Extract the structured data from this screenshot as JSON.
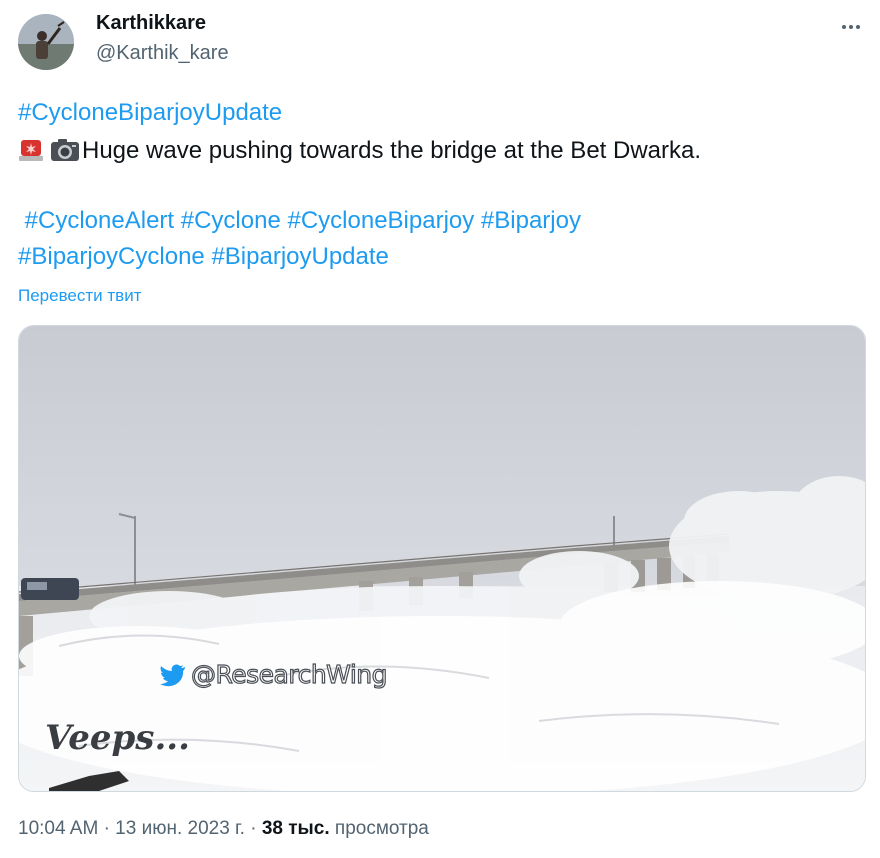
{
  "author": {
    "name": "Karthikkare",
    "handle": "@Karthik_kare"
  },
  "tweet": {
    "hashtag_top": "#CycloneBiparjoyUpdate",
    "emoji": [
      "rotating-light-icon",
      "camera-icon"
    ],
    "body": "Huge wave pushing towards the bridge at the Bet Dwarka.",
    "hashtags_line1": [
      "#CycloneAlert",
      "#Cyclone",
      "#CycloneBiparjoy",
      "#Biparjoy"
    ],
    "hashtags_line2": [
      "#BiparjoyCyclone",
      "#BiparjoyUpdate"
    ],
    "translate": "Перевести твит"
  },
  "media": {
    "watermark_handle": "@ResearchWing",
    "watermark_signature": "Veeps..."
  },
  "meta": {
    "time": "10:04 AM",
    "separator": "·",
    "date": "13 июн. 2023 г.",
    "views_count": "38 тыс.",
    "views_label": "просмотра"
  },
  "colors": {
    "link": "#1d9bf0",
    "text": "#0f1419",
    "secondary": "#536471"
  }
}
